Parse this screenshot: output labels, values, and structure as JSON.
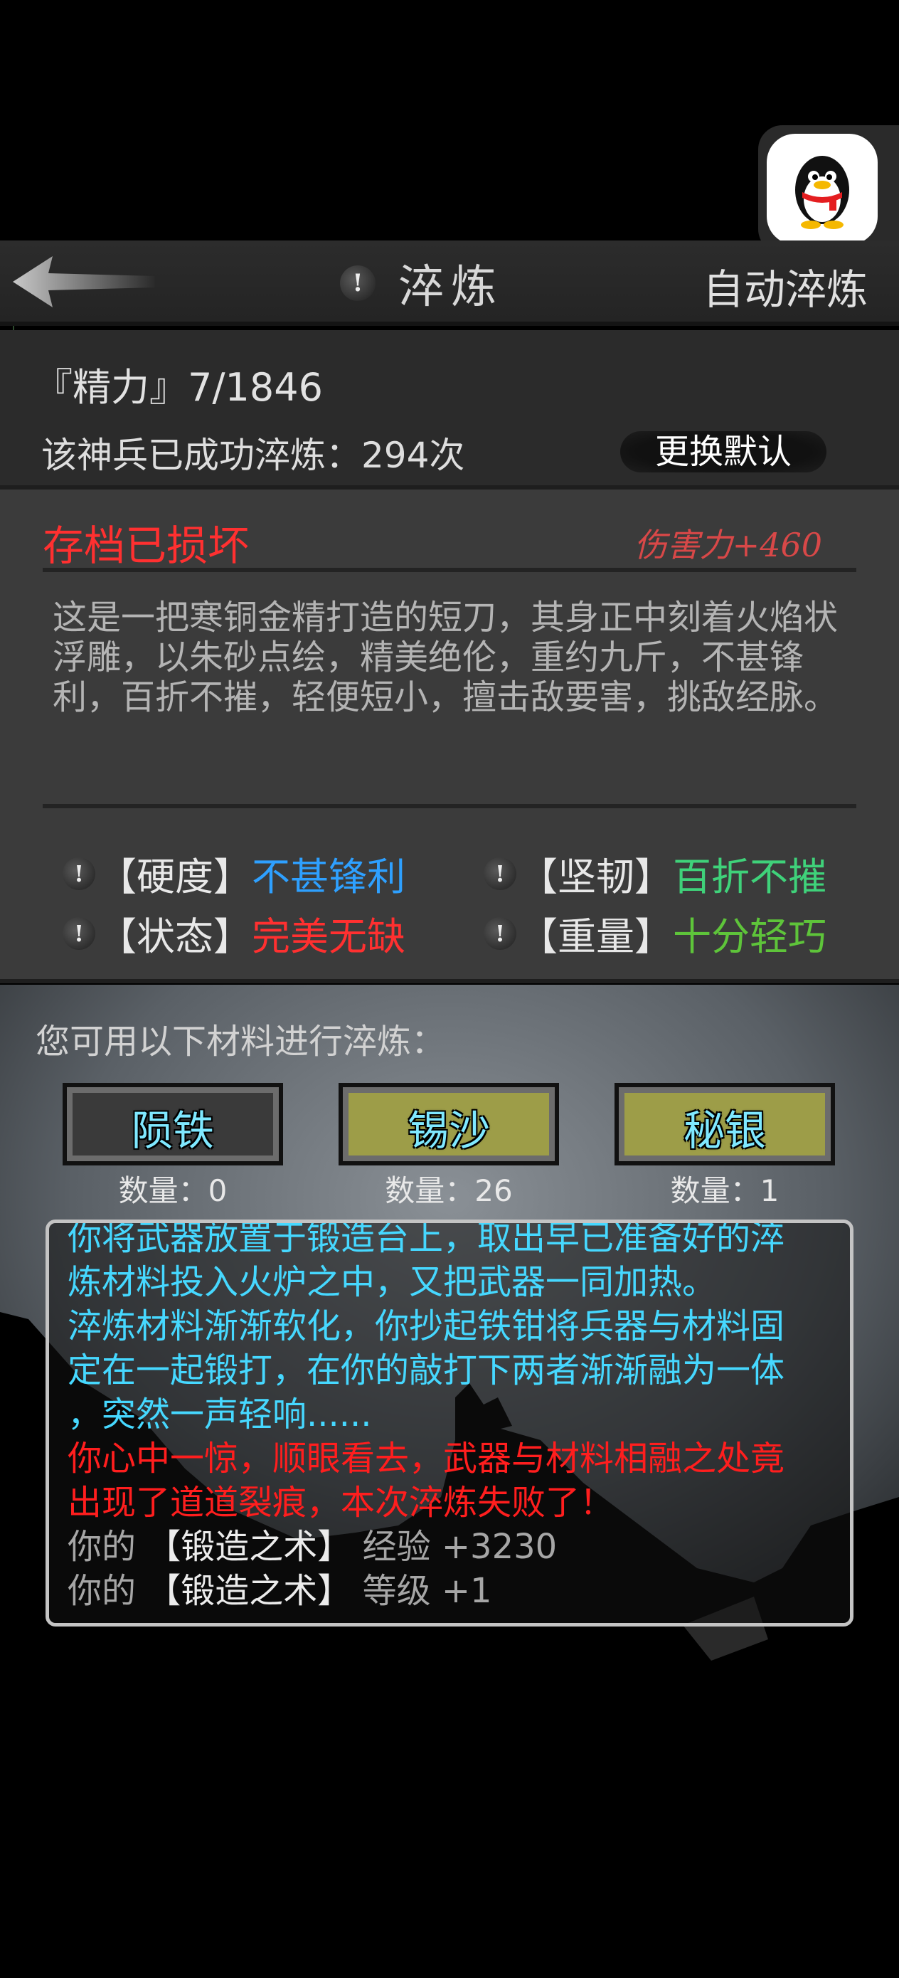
{
  "colors": {
    "accent_cyan": "#46d8ff",
    "red": "#ff3030",
    "blue": "#2ea0ff",
    "green": "#3fd27a",
    "lime": "#5ec43a",
    "material_gray": "#3a3a3a",
    "material_olive": "#9d9d48"
  },
  "qq_badge": {
    "icon": "qq-penguin-icon"
  },
  "header": {
    "back_icon": "back-arrow-icon",
    "info_icon": "info-exclamation-icon",
    "info_symbol": "!",
    "title": "淬炼",
    "auto_label": "自动淬炼"
  },
  "status": {
    "energy": "『精力』7/1846",
    "refine_count": "该神兵已成功淬炼：294次",
    "switch_default": "更换默认"
  },
  "weapon": {
    "save_status": "存档已损坏",
    "damage": "伤害力+460",
    "description": "这是一把寒铜金精打造的短刀，其身正中刻着火焰状浮雕，以朱砂点绘，精美绝伦，重约九斤，不甚锋利，百折不摧，轻便短小，擅击敌要害，挑敌经脉。",
    "attributes": [
      {
        "key": "【硬度】",
        "value": "不甚锋利"
      },
      {
        "key": "【坚韧】",
        "value": "百折不摧"
      },
      {
        "key": "【状态】",
        "value": "完美无缺"
      },
      {
        "key": "【重量】",
        "value": "十分轻巧"
      }
    ]
  },
  "materials": {
    "title": "您可用以下材料进行淬炼：",
    "items": [
      {
        "name": "陨铁",
        "count": "数量：0"
      },
      {
        "name": "锡沙",
        "count": "数量：26"
      },
      {
        "name": "秘银",
        "count": "数量：1"
      }
    ]
  },
  "log": {
    "lines": [
      "你将武器放置于锻造台上，取出早已准备好的淬",
      "炼材料投入火炉之中，又把武器一同加热。",
      "淬炼材料渐渐软化，你抄起铁钳将兵器与材料固",
      "定在一起锻打，在你的敲打下两者渐渐融为一体",
      "，突然一声轻响......",
      "你心中一惊，顺眼看去，武器与材料相融之处竟",
      "出现了道道裂痕，本次淬炼失败了！"
    ],
    "skill_exp": {
      "prefix": "你的",
      "skill": "【锻造之术】",
      "suffix": "经验 +3230"
    },
    "skill_level": {
      "prefix": "你的",
      "skill": "【锻造之术】",
      "suffix": "等级 +1"
    }
  }
}
